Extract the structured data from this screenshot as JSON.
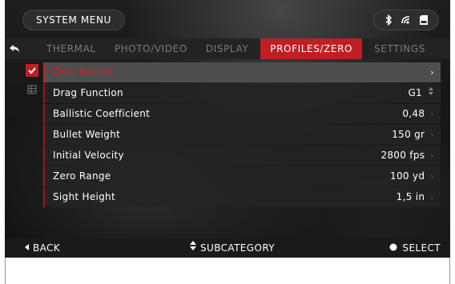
{
  "header": {
    "title": "SYSTEM MENU"
  },
  "status_icons": [
    "bluetooth-icon",
    "wifi-icon",
    "sd-card-icon"
  ],
  "tabs": [
    {
      "label": "THERMAL",
      "active": false
    },
    {
      "label": "PHOTO/VIDEO",
      "active": false
    },
    {
      "label": "DISPLAY",
      "active": false
    },
    {
      "label": "PROFILES/ZERO",
      "active": true
    },
    {
      "label": "SETTINGS",
      "active": false
    }
  ],
  "side_icons": [
    "checkbox-icon",
    "table-icon"
  ],
  "menu": [
    {
      "label": "Zero Reticle",
      "value": ""
    },
    {
      "label": "Drag Function",
      "value": "G1"
    },
    {
      "label": "Ballistic Coefficient",
      "value": "0,48"
    },
    {
      "label": "Bullet Weight",
      "value": "150 gr"
    },
    {
      "label": "Initial Velocity",
      "value": "2800 fps"
    },
    {
      "label": "Zero Range",
      "value": "100 yd"
    },
    {
      "label": "Sight Height",
      "value": "1,5 in"
    }
  ],
  "footer": {
    "back_label": "BACK",
    "subcategory_label": "SUBCATEGORY",
    "select_label": "SELECT"
  },
  "colors": {
    "accent": "#bf1e23",
    "background": "#151515",
    "row_bg": "#242424"
  }
}
